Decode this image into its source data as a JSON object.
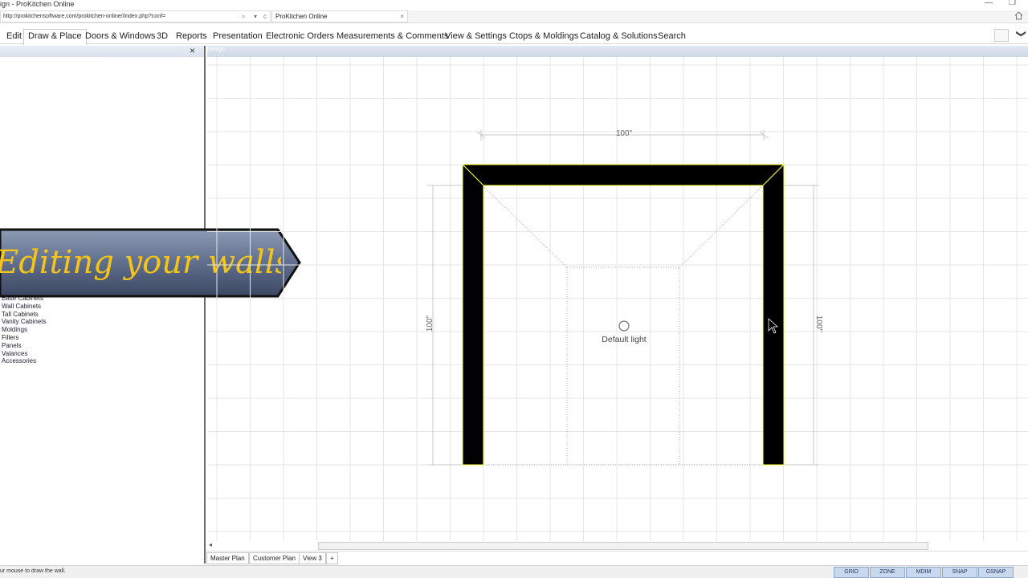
{
  "window": {
    "title": "ign - ProKitchen Online"
  },
  "browser": {
    "url": "http://prokitchensoftware.com/prokitchen-online//index.php?conf=",
    "tab_title": "ProKitchen Online",
    "tab_close": "×",
    "addr_search": "⌕",
    "addr_dropdown": "▾",
    "addr_refresh": "c"
  },
  "window_controls": {
    "minimize": "—",
    "restore": "❐"
  },
  "menu": {
    "items": [
      "Edit",
      "Draw & Place",
      "Doors & Windows",
      "3D",
      "Reports",
      "Presentation",
      "Electronic Orders",
      "Measurements & Comments",
      "View & Settings",
      "Ctops & Moldings",
      "Catalog & Solutions",
      "Search"
    ],
    "active": "Draw & Place",
    "chevron": "❯"
  },
  "sidebar": {
    "close_icon": "×",
    "categories": [
      "Base Cabinets",
      "Wall Cabinets",
      "Tall Cabinets",
      "Vanity Cabinets",
      "Moldings",
      "Fillers",
      "Panels",
      "Valances",
      "Accessories"
    ]
  },
  "banner": {
    "text": "Editing your walls"
  },
  "canvas": {
    "header": "Design",
    "dim_top": "100\"",
    "dim_left": "100\"",
    "dim_right": "100\"",
    "light_label": "Default light"
  },
  "scroll": {
    "left_arrow": "◂"
  },
  "plan_tabs": [
    "Master Plan",
    "Customer Plan",
    "View 3",
    "+"
  ],
  "status": {
    "message": "ur mouse to draw the wall.",
    "toggles": [
      "GRID",
      "ZONE",
      "MDIM",
      "SNAP",
      "GSNAP"
    ]
  },
  "colors": {
    "wall": "#000000",
    "wall_outline": "#ffff33",
    "grid": "#e6e6e6",
    "toggle_bg": "#c7d8ef",
    "banner_text": "#f4c419"
  }
}
